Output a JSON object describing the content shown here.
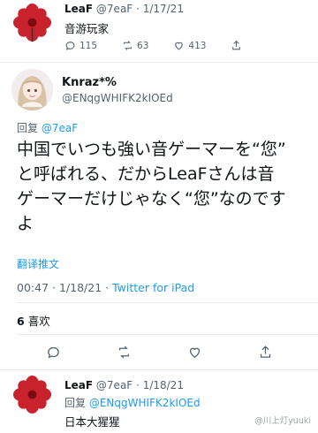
{
  "tweet1": {
    "name": "LeaF",
    "handle": "@7eaF",
    "date": "1/17/21",
    "text": "音游玩家",
    "replies": "115",
    "retweets": "63",
    "likes": "413"
  },
  "main_tweet": {
    "name": "Knraz*%",
    "handle": "@ENqgWHIFK2kIOEd",
    "reply_prefix": "回复",
    "reply_to": "@7eaF",
    "lines": [
      "中国でいつも強い音ゲーマーを“您”",
      "と呼ばれる、だからLeaFさんは音",
      "ゲーマーだけじゃなく“您”なのです",
      "よ"
    ],
    "translate_label": "翻译推文",
    "time": "00:47",
    "date": "1/18/21",
    "source": "Twitter for iPad",
    "likes_count": "6",
    "likes_label": "喜欢"
  },
  "tweet3": {
    "name": "LeaF",
    "handle": "@7eaF",
    "date": "1/18/21",
    "reply_prefix": "回复",
    "reply_to": "@ENqgWHIFK2kIOEd",
    "text": "日本大猩猩"
  },
  "watermark": "@川上灯yuuki",
  "colors": {
    "accent": "#1d9bf0",
    "muted": "#536471",
    "divider": "#e6ecf0"
  }
}
